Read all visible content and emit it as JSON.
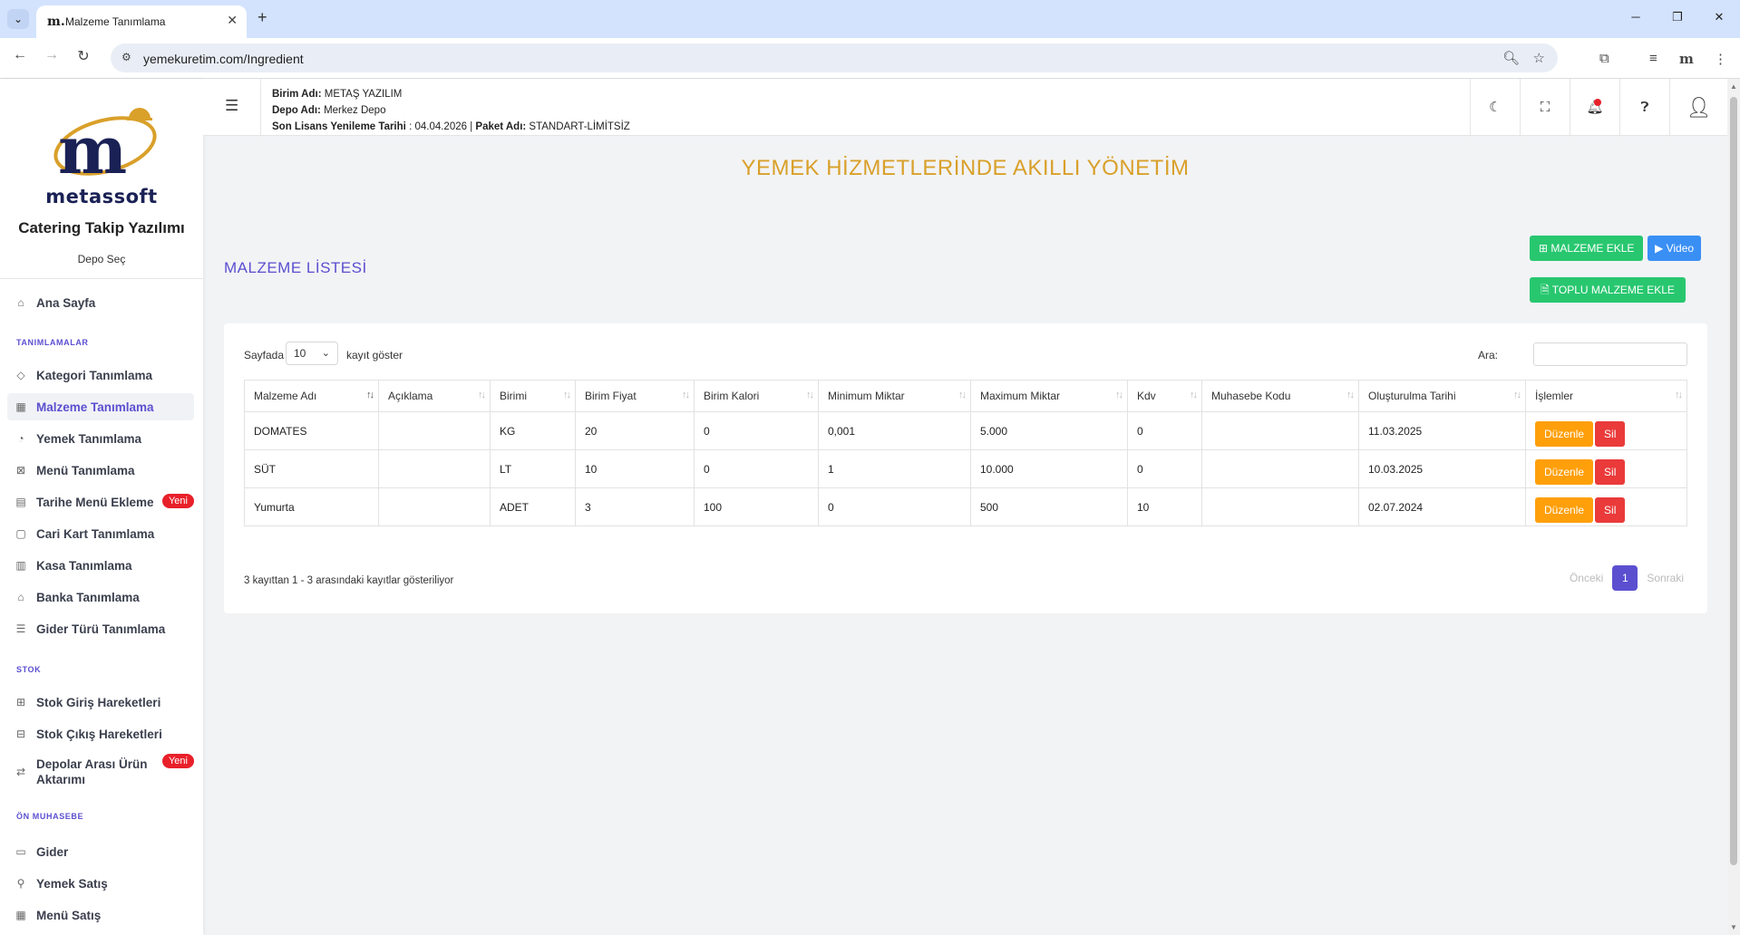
{
  "browser": {
    "tab_title": "Malzeme Tanımlama",
    "tab_favicon": "m.",
    "url": "yemekuretim.com/Ingredient"
  },
  "sidebar": {
    "logo_text": "metassoft",
    "app_name": "Catering Takip Yazılımı",
    "depo_select": "Depo Seç",
    "home": "Ana Sayfa",
    "sections": {
      "definitions": "TANIMLAMALAR",
      "stock": "STOK",
      "accounting": "ÖN MUHASEBE"
    },
    "items": [
      {
        "label": "Kategori Tanımlama",
        "icon": "tag-icon"
      },
      {
        "label": "Malzeme Tanımlama",
        "icon": "ingredient-icon"
      },
      {
        "label": "Yemek Tanımlama",
        "icon": "dish-icon"
      },
      {
        "label": "Menü Tanımlama",
        "icon": "menu-icon"
      },
      {
        "label": "Tarihe Menü Ekleme",
        "icon": "calendar-icon",
        "badge": "Yeni"
      },
      {
        "label": "Cari Kart Tanımlama",
        "icon": "card-icon"
      },
      {
        "label": "Kasa Tanımlama",
        "icon": "register-icon"
      },
      {
        "label": "Banka Tanımlama",
        "icon": "bank-icon"
      },
      {
        "label": "Gider Türü Tanımlama",
        "icon": "list-icon"
      }
    ],
    "stock_items": [
      {
        "label": "Stok Giriş Hareketleri",
        "icon": "stock-in-icon"
      },
      {
        "label": "Stok Çıkış Hareketleri",
        "icon": "stock-out-icon"
      },
      {
        "label": "Depolar Arası Ürün Aktarımı",
        "icon": "transfer-icon",
        "badge": "Yeni"
      }
    ],
    "accounting_items": [
      {
        "label": "Gider",
        "icon": "expense-icon"
      },
      {
        "label": "Yemek Satış",
        "icon": "food-sale-icon"
      },
      {
        "label": "Menü Satış",
        "icon": "menu-sale-icon"
      }
    ]
  },
  "header": {
    "birim_label": "Birim Adı:",
    "birim_value": "METAŞ YAZILIM",
    "depo_label": "Depo Adı:",
    "depo_value": "Merkez Depo",
    "lisans_label": "Son Lisans Yenileme Tarihi",
    "lisans_value": ": 04.04.2026 |",
    "paket_label": "Paket Adı:",
    "paket_value": "STANDART-LİMİTSİZ"
  },
  "main": {
    "headline": "YEMEK HİZMETLERİNDE AKILLI YÖNETİM",
    "list_title": "MALZEME LİSTESİ",
    "add_button": "MALZEME EKLE",
    "video_button": "Video",
    "bulk_button": "TOPLU MALZEME EKLE",
    "length_prefix": "Sayfada",
    "length_value": "10",
    "length_suffix": "kayıt göster",
    "search_label": "Ara:",
    "columns": [
      "Malzeme Adı",
      "Açıklama",
      "Birimi",
      "Birim Fiyat",
      "Birim Kalori",
      "Minimum Miktar",
      "Maximum Miktar",
      "Kdv",
      "Muhasebe Kodu",
      "Oluşturulma Tarihi",
      "İşlemler"
    ],
    "rows": [
      {
        "name": "DOMATES",
        "desc": "",
        "unit": "KG",
        "price": "20",
        "kcal": "0",
        "min": "0,001",
        "max": "5.000",
        "kdv": "0",
        "code": "",
        "date": "11.03.2025"
      },
      {
        "name": "SÜT",
        "desc": "",
        "unit": "LT",
        "price": "10",
        "kcal": "0",
        "min": "1",
        "max": "10.000",
        "kdv": "0",
        "code": "",
        "date": "10.03.2025"
      },
      {
        "name": "Yumurta",
        "desc": "",
        "unit": "ADET",
        "price": "3",
        "kcal": "100",
        "min": "0",
        "max": "500",
        "kdv": "10",
        "code": "",
        "date": "02.07.2024"
      }
    ],
    "edit_label": "Düzenle",
    "delete_label": "Sil",
    "info_text": "3 kayıttan 1 - 3 arasındaki kayıtlar gösteriliyor",
    "pager": {
      "prev": "Önceki",
      "current": "1",
      "next": "Sonraki"
    }
  },
  "colors": {
    "accent": "#5b4fd0",
    "headline": "#d9a02a",
    "green": "#28c76f",
    "blue": "#3a8ff5",
    "edit": "#ff9f0a",
    "delete": "#ea3a3a",
    "badge": "#e8202a"
  }
}
